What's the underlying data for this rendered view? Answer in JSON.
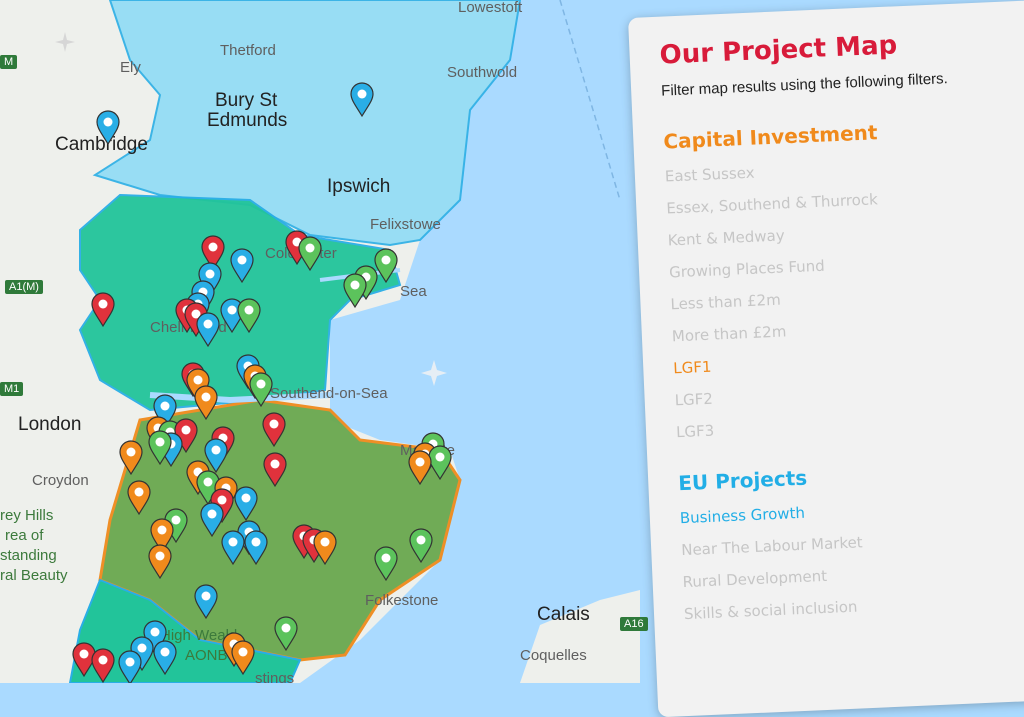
{
  "panel": {
    "title": "Our Project Map",
    "subtitle": "Filter map results using the following filters.",
    "sections": [
      {
        "heading": "Capital Investment",
        "color": "#f08a1c",
        "items": [
          {
            "label": "East Sussex",
            "active": false
          },
          {
            "label": "Essex, Southend & Thurrock",
            "active": false
          },
          {
            "label": "Kent & Medway",
            "active": false
          },
          {
            "label": "Growing Places Fund",
            "active": false
          },
          {
            "label": "Less than £2m",
            "active": false
          },
          {
            "label": "More than £2m",
            "active": false
          },
          {
            "label": "LGF1",
            "active": true
          },
          {
            "label": "LGF2",
            "active": false
          },
          {
            "label": "LGF3",
            "active": false
          }
        ]
      },
      {
        "heading": "EU Projects",
        "color": "#22aee6",
        "items": [
          {
            "label": "Business Growth",
            "active": true
          },
          {
            "label": "Near The Labour Market",
            "active": false
          },
          {
            "label": "Rural Development",
            "active": false
          },
          {
            "label": "Skills & social inclusion",
            "active": false
          }
        ]
      }
    ]
  },
  "map": {
    "place_labels": [
      "Lowestoft",
      "Thetford",
      "Southwold",
      "Ely",
      "Bury St",
      "Edmunds",
      "Cambridge",
      "Ipswich",
      "Felixstowe",
      "London",
      "Croydon",
      "Margate",
      "Folkestone",
      "Calais",
      "Coquelles",
      "Colchester",
      "Sea",
      "Chelmsford",
      "Southend-on-Sea"
    ],
    "green_labels": [
      "rey Hills",
      "rea of",
      "standing",
      "ral Beauty",
      "High Weald",
      "AONB",
      "stings"
    ],
    "road_shields": [
      "A1(M)",
      "M1",
      "A16",
      "M"
    ],
    "colors": {
      "red": "#e0323c",
      "blue": "#29aee6",
      "green": "#5cc35c",
      "orange": "#f08a1c",
      "region_teal": "#22c49a",
      "region_olive": "#6aa84f",
      "region_light": "#8fdcf5",
      "sea": "#aadaff"
    },
    "marker_color_names": [
      "red",
      "blue",
      "green",
      "orange"
    ]
  }
}
